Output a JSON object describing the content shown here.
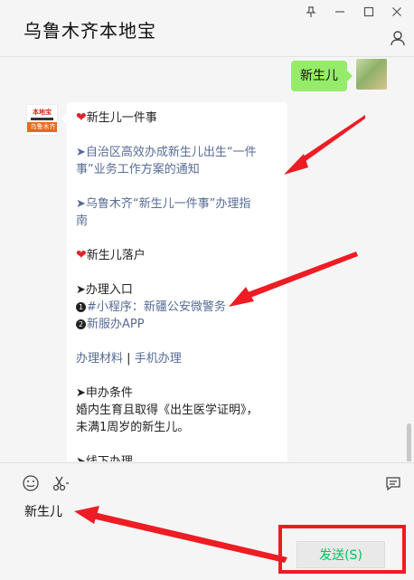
{
  "window": {
    "title": "乌鲁木齐本地宝",
    "controls": [
      "pin-icon",
      "minimize-icon",
      "maximize-icon",
      "close-icon"
    ]
  },
  "chat": {
    "self_message": "新生儿",
    "bot_avatar": {
      "logo_text": "本地宝",
      "name_tag": "乌鲁木齐"
    },
    "bot_message": {
      "section1_title": "新生儿一件事",
      "link1": "➤自治区高效办成新生儿出生“一件事”业务工作方案的通知",
      "link1_line1": "➤自治区高效办成新生儿出生“一件",
      "link1_line2": "事”业务工作方案的通知",
      "link2_line1": "➤乌鲁木齐“新生儿一件事”办理指",
      "link2_line2": "南",
      "section2_title": "新生儿落户",
      "entry_title": "➤办理入口",
      "entry1_num": "1",
      "entry1": "#小程序：新疆公安微警务",
      "entry2_num": "2",
      "entry2": "新服办APP",
      "materials_link": "办理材料",
      "separator": "|",
      "mobile_link": "手机办理",
      "conditions_title": "➤申办条件",
      "conditions_line1": "婚内生育且取得《出生医学证明》，",
      "conditions_line2": "未满1周岁的新生儿。",
      "offline_title": "➤线下办理"
    }
  },
  "input": {
    "text": "新生儿",
    "send_label": "发送(S)",
    "tools": [
      "emoji-icon",
      "scissors-icon",
      "chat-history-icon"
    ]
  },
  "colors": {
    "self_bubble": "#95ec69",
    "link": "#576b95",
    "annotation_red": "#ee1c24",
    "send_text": "#07c160"
  }
}
